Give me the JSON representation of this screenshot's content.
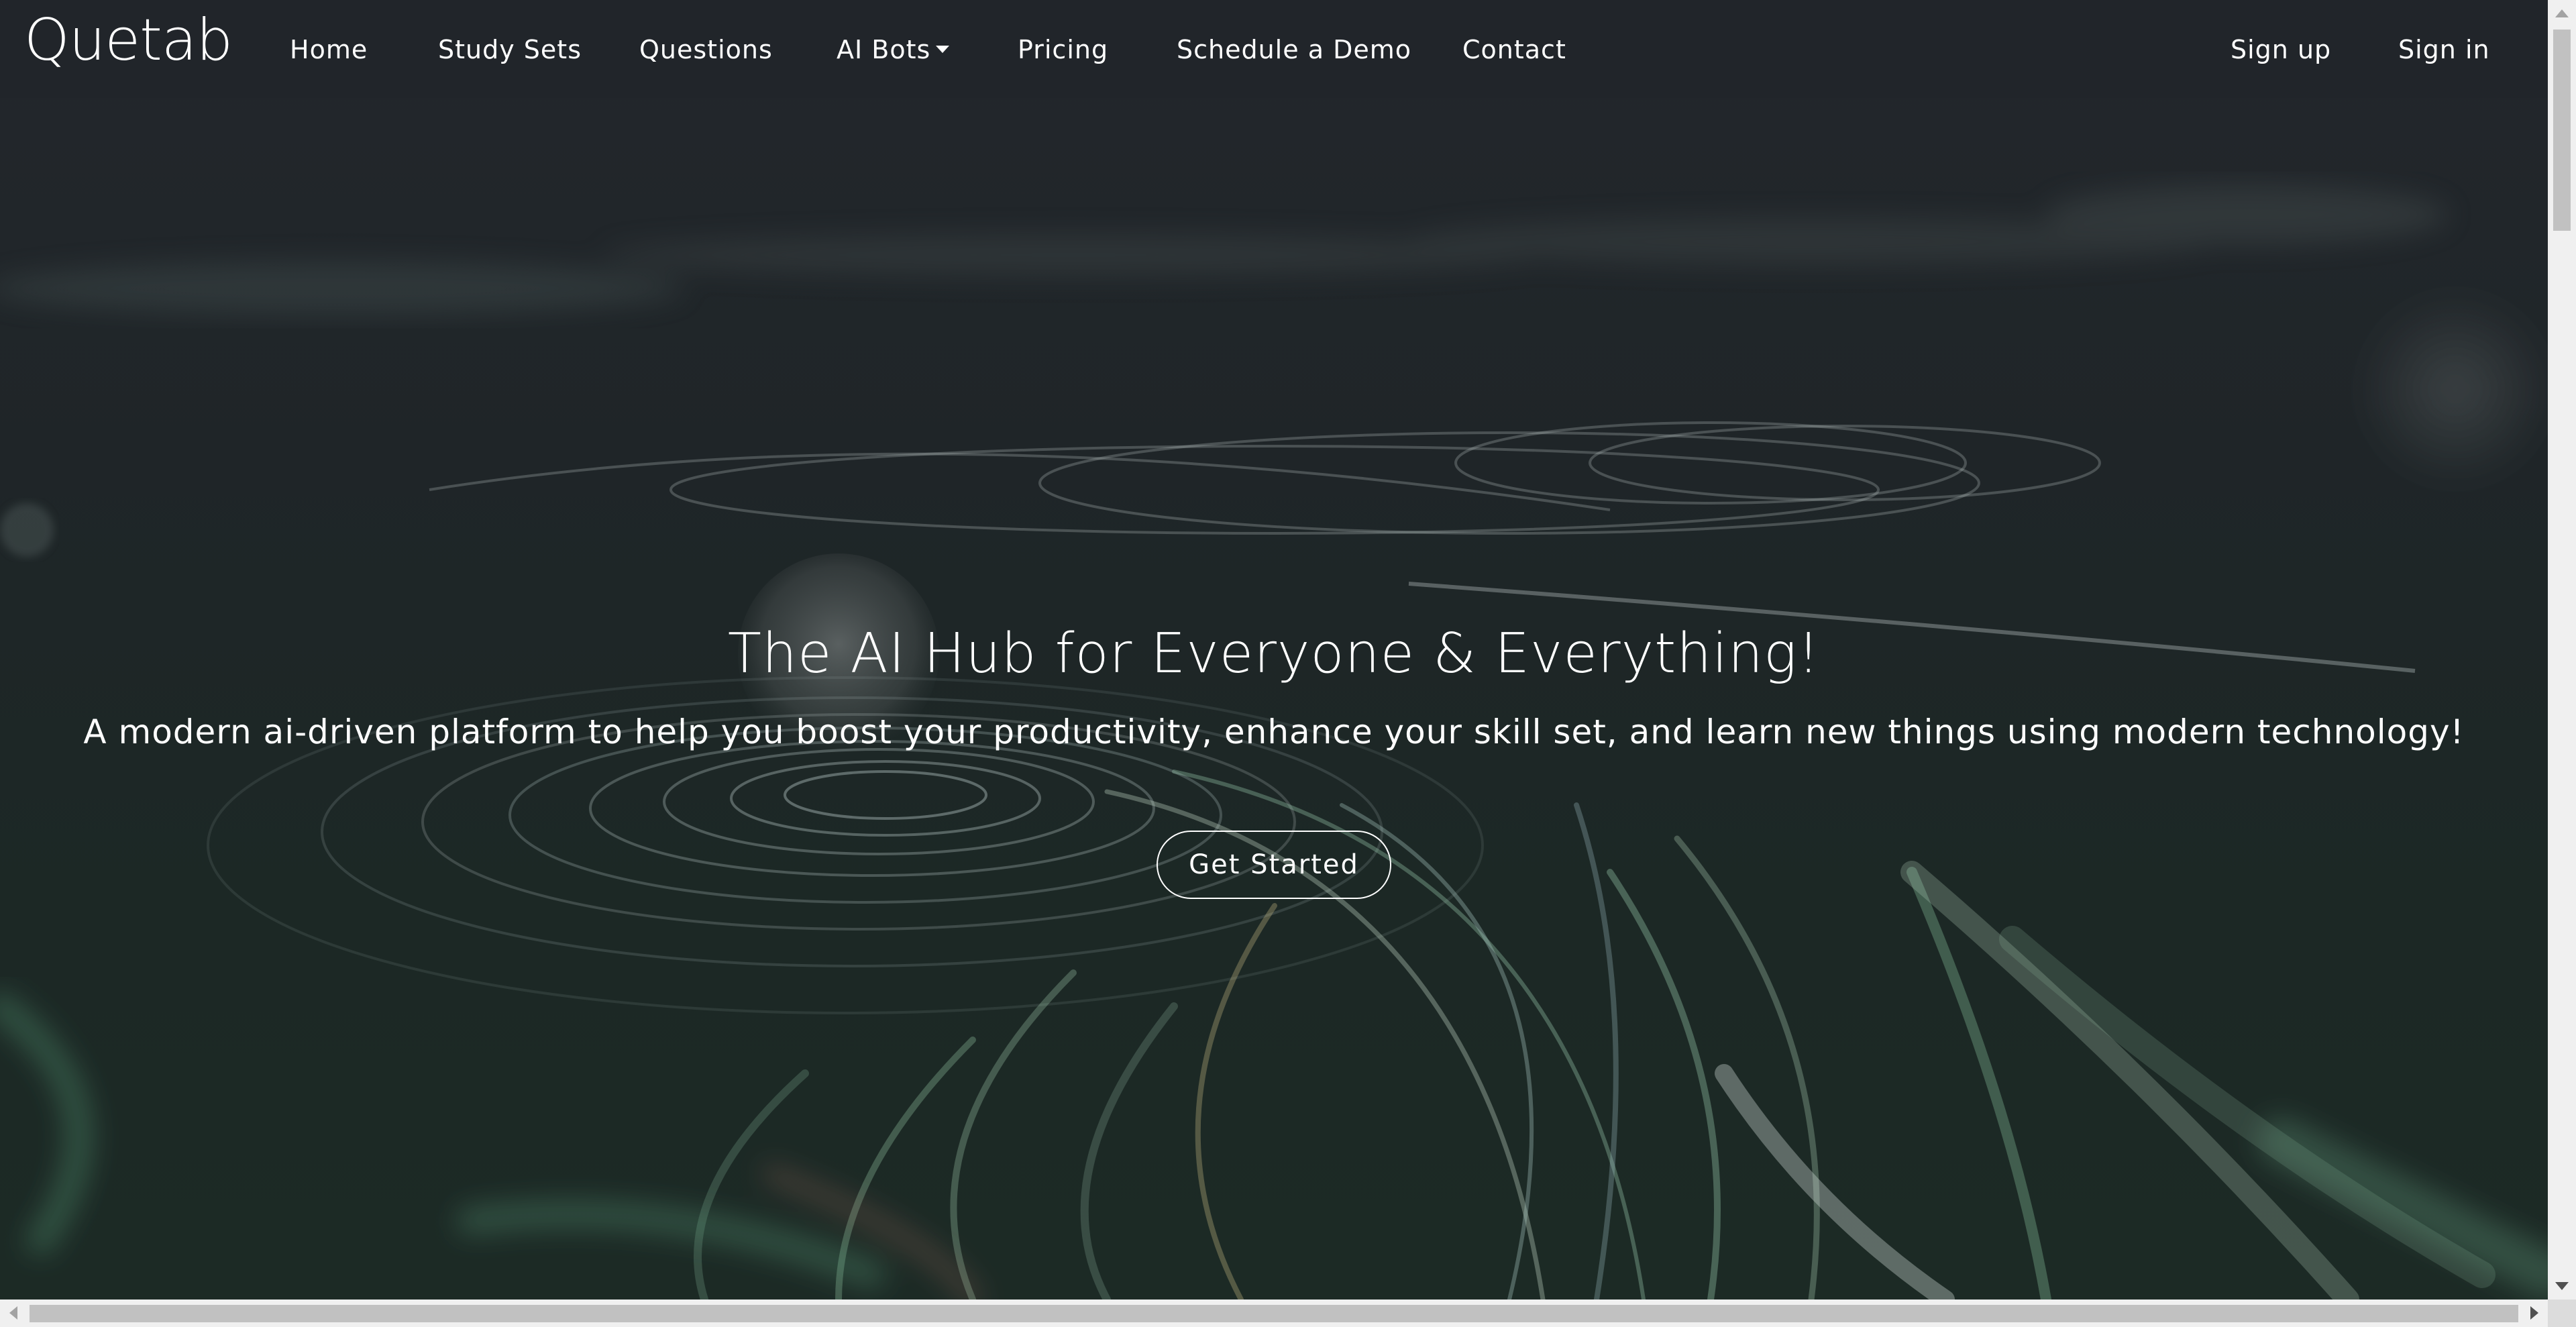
{
  "navbar": {
    "brand": "Quetab",
    "items": [
      {
        "label": "Home"
      },
      {
        "label": "Study Sets"
      },
      {
        "label": "Questions"
      },
      {
        "label": "AI Bots"
      },
      {
        "label": "Pricing"
      },
      {
        "label": "Schedule a Demo"
      },
      {
        "label": "Contact"
      }
    ],
    "auth": {
      "signup": "Sign up",
      "signin": "Sign in"
    }
  },
  "hero": {
    "title": "The AI Hub for Everyone & Everything!",
    "subtitle": "A modern ai-driven platform to help you boost your productivity, enhance your skill set, and learn new things using modern technology!",
    "cta": "Get Started"
  },
  "icons": {
    "dropdown": "caret-down-icon"
  },
  "colors": {
    "nav_bg": "#22252a",
    "hero_bg": "#1f2528",
    "text": "#ffffff"
  }
}
